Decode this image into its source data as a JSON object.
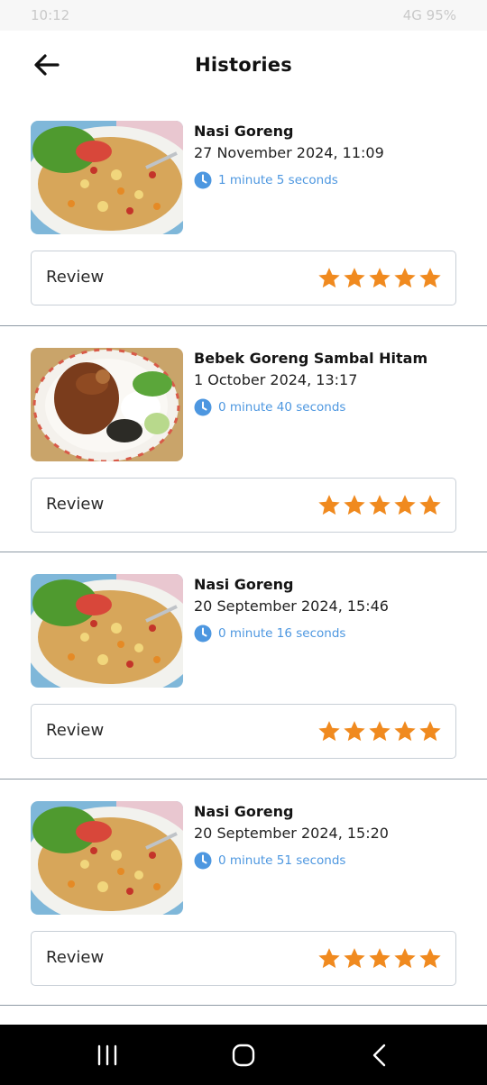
{
  "status_bar": {
    "time": "10:12",
    "right": "4G 95%"
  },
  "header": {
    "title": "Histories"
  },
  "items": [
    {
      "name": "Nasi Goreng",
      "date": "27 November 2024, 11:09",
      "duration": "1 minute 5 seconds",
      "review_label": "Review",
      "rating": 5
    },
    {
      "name": "Bebek Goreng Sambal Hitam",
      "date": "1 October 2024, 13:17",
      "duration": "0 minute 40 seconds",
      "review_label": "Review",
      "rating": 5
    },
    {
      "name": "Nasi Goreng",
      "date": "20 September 2024, 15:46",
      "duration": "0 minute 16 seconds",
      "review_label": "Review",
      "rating": 5
    },
    {
      "name": "Nasi Goreng",
      "date": "20 September 2024, 15:20",
      "duration": "0 minute 51 seconds",
      "review_label": "Review",
      "rating": 5
    }
  ],
  "icons": {
    "back": "arrow-left-icon",
    "clock": "clock-icon",
    "star": "star-icon",
    "nav": [
      "recent-apps-icon",
      "home-icon",
      "back-chevron-icon"
    ]
  },
  "colors": {
    "star": "#f08a1f",
    "duration": "#4d97e0",
    "divider": "#8e9aa5"
  }
}
